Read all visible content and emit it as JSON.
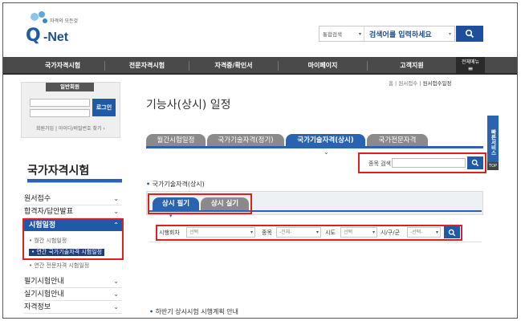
{
  "header": {
    "logo_tagline": "자격의 모든것",
    "logo_q": "Q",
    "logo_net": "-Net",
    "search_scope": "통합검색",
    "search_placeholder": "검색어를 입력하세요"
  },
  "nav": {
    "items": [
      "국가자격시험",
      "전문자격시험",
      "자격증/확인서",
      "마이페이지",
      "고객지원"
    ],
    "all_menu_line1": "전체메뉴",
    "all_menu_line2": "≡"
  },
  "login": {
    "header": "일반회원",
    "button": "로그인",
    "links": "회원가입 | 아이디/비밀번호 찾기 ›"
  },
  "sidebar": {
    "title": "국가자격시험",
    "items_top": [
      {
        "label": "원서접수"
      },
      {
        "label": "합격자/답안발표"
      }
    ],
    "open_section": {
      "label": "시험일정",
      "sub_items": [
        {
          "label": "• 월간 시험일정"
        },
        {
          "label": "• 연간 국가기술자격 시험일정"
        },
        {
          "label": "• 연간 전문자격 시험일정"
        }
      ]
    },
    "items_bottom": [
      {
        "label": "필기시험안내"
      },
      {
        "label": "실기시험안내"
      },
      {
        "label": "자격정보"
      }
    ]
  },
  "breadcrumb": {
    "home": "홈",
    "level1": "원서접수",
    "current": "원서접수일정"
  },
  "page": {
    "title": "기능사(상시) 일정"
  },
  "service_rail": {
    "label": "빠른서비스",
    "top": "TOP"
  },
  "tabs": [
    {
      "label": "월간시험일정",
      "active": false
    },
    {
      "label": "국가기술자격(정기)",
      "active": false
    },
    {
      "label": "국가기술자격(상시)",
      "active": true
    },
    {
      "label": "국가전문자격",
      "active": false
    }
  ],
  "item_search": {
    "label": "종목 검색"
  },
  "section": {
    "label": "국가기술자격(상시)",
    "bottom_label": "하반기 상시시험 시행계획 안내"
  },
  "subtabs": [
    {
      "label": "상시 필기",
      "active": true
    },
    {
      "label": "상시 실기",
      "active": false
    }
  ],
  "filters": {
    "round_label": "시행회차",
    "round_value": "선택",
    "item_label": "종목",
    "item_value": "-전체-",
    "region_label": "시도",
    "region_value": "선택",
    "district_label": "시/구/군",
    "district_value": "-선택-"
  },
  "colors": {
    "brand_blue": "#1f5aa6",
    "tab_active": "#2a63b0",
    "nav_bg": "#4a4a4a",
    "highlight_red": "#e02020"
  }
}
